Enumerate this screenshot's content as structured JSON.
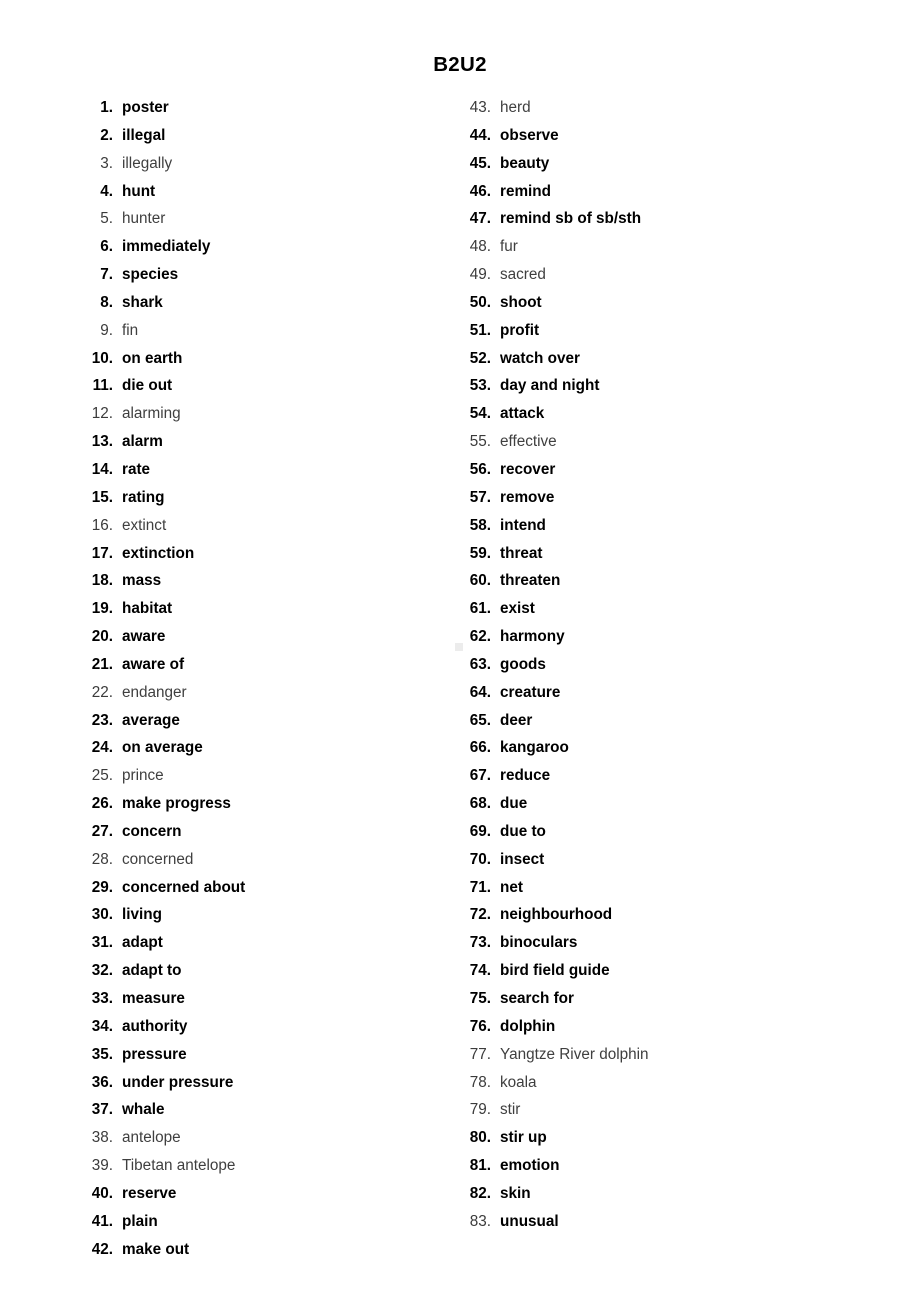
{
  "document": {
    "title": "B2U2"
  },
  "columns": {
    "left": {
      "name": "left-column",
      "items": [
        {
          "number": "1.",
          "text": "poster",
          "number_bold": true,
          "text_bold": true
        },
        {
          "number": "2.",
          "text": "illegal",
          "number_bold": true,
          "text_bold": true
        },
        {
          "number": "3.",
          "text": "illegally",
          "number_bold": false,
          "text_bold": false
        },
        {
          "number": "4.",
          "text": "hunt",
          "number_bold": true,
          "text_bold": true
        },
        {
          "number": "5.",
          "text": "hunter",
          "number_bold": false,
          "text_bold": false
        },
        {
          "number": "6.",
          "text": "immediately",
          "number_bold": true,
          "text_bold": true
        },
        {
          "number": "7.",
          "text": "species",
          "number_bold": true,
          "text_bold": true
        },
        {
          "number": "8.",
          "text": "shark",
          "number_bold": true,
          "text_bold": true
        },
        {
          "number": "9.",
          "text": "fin",
          "number_bold": false,
          "text_bold": false
        },
        {
          "number": "10.",
          "text": "on earth",
          "number_bold": true,
          "text_bold": true
        },
        {
          "number": "11.",
          "text": "die out",
          "number_bold": true,
          "text_bold": true
        },
        {
          "number": "12.",
          "text": "alarming",
          "number_bold": false,
          "text_bold": false
        },
        {
          "number": "13.",
          "text": "alarm",
          "number_bold": true,
          "text_bold": true
        },
        {
          "number": "14.",
          "text": "rate",
          "number_bold": true,
          "text_bold": true
        },
        {
          "number": "15.",
          "text": "rating",
          "number_bold": true,
          "text_bold": true
        },
        {
          "number": "16.",
          "text": "extinct",
          "number_bold": false,
          "text_bold": false
        },
        {
          "number": "17.",
          "text": "extinction",
          "number_bold": true,
          "text_bold": true
        },
        {
          "number": "18.",
          "text": "mass",
          "number_bold": true,
          "text_bold": true
        },
        {
          "number": "19.",
          "text": "habitat",
          "number_bold": true,
          "text_bold": true
        },
        {
          "number": "20.",
          "text": "aware",
          "number_bold": true,
          "text_bold": true
        },
        {
          "number": "21.",
          "text": "aware of",
          "number_bold": true,
          "text_bold": true
        },
        {
          "number": "22.",
          "text": "endanger",
          "number_bold": false,
          "text_bold": false
        },
        {
          "number": "23.",
          "text": "average",
          "number_bold": true,
          "text_bold": true
        },
        {
          "number": "24.",
          "text": "on average",
          "number_bold": true,
          "text_bold": true
        },
        {
          "number": "25.",
          "text": "prince",
          "number_bold": false,
          "text_bold": false
        },
        {
          "number": "26.",
          "text": "make progress",
          "number_bold": true,
          "text_bold": true
        },
        {
          "number": "27.",
          "text": "concern",
          "number_bold": true,
          "text_bold": true
        },
        {
          "number": "28.",
          "text": "concerned",
          "number_bold": false,
          "text_bold": false
        },
        {
          "number": "29.",
          "text": "concerned about",
          "number_bold": true,
          "text_bold": true
        },
        {
          "number": "30.",
          "text": "living",
          "number_bold": true,
          "text_bold": true
        },
        {
          "number": "31.",
          "text": "adapt",
          "number_bold": true,
          "text_bold": true
        },
        {
          "number": "32.",
          "text": "adapt to",
          "number_bold": true,
          "text_bold": true
        },
        {
          "number": "33.",
          "text": "measure",
          "number_bold": true,
          "text_bold": true
        },
        {
          "number": "34.",
          "text": "authority",
          "number_bold": true,
          "text_bold": true
        },
        {
          "number": "35.",
          "text": "pressure",
          "number_bold": true,
          "text_bold": true
        },
        {
          "number": "36.",
          "text": "under pressure",
          "number_bold": true,
          "text_bold": true
        },
        {
          "number": "37.",
          "text": "whale",
          "number_bold": true,
          "text_bold": true
        },
        {
          "number": "38.",
          "text": "antelope",
          "number_bold": false,
          "text_bold": false
        },
        {
          "number": "39.",
          "text": "Tibetan antelope",
          "number_bold": false,
          "text_bold": false
        },
        {
          "number": "40.",
          "text": "reserve",
          "number_bold": true,
          "text_bold": true
        },
        {
          "number": "41.",
          "text": "plain",
          "number_bold": true,
          "text_bold": true
        },
        {
          "number": "42.",
          "text": "make out",
          "number_bold": true,
          "text_bold": true
        }
      ]
    },
    "right": {
      "name": "right-column",
      "items": [
        {
          "number": "43.",
          "text": "herd",
          "number_bold": false,
          "text_bold": false
        },
        {
          "number": "44.",
          "text": "observe",
          "number_bold": true,
          "text_bold": true
        },
        {
          "number": "45.",
          "text": "beauty",
          "number_bold": true,
          "text_bold": true
        },
        {
          "number": "46.",
          "text": "remind",
          "number_bold": true,
          "text_bold": true
        },
        {
          "number": "47.",
          "text": "remind sb of sb/sth",
          "number_bold": true,
          "text_bold": true
        },
        {
          "number": "48.",
          "text": "fur",
          "number_bold": false,
          "text_bold": false
        },
        {
          "number": "49.",
          "text": "sacred",
          "number_bold": false,
          "text_bold": false
        },
        {
          "number": "50.",
          "text": "shoot",
          "number_bold": true,
          "text_bold": true
        },
        {
          "number": "51.",
          "text": "profit",
          "number_bold": true,
          "text_bold": true
        },
        {
          "number": "52.",
          "text": "watch over",
          "number_bold": true,
          "text_bold": true
        },
        {
          "number": "53.",
          "text": "day and night",
          "number_bold": true,
          "text_bold": true
        },
        {
          "number": "54.",
          "text": "attack",
          "number_bold": true,
          "text_bold": true
        },
        {
          "number": "55.",
          "text": "effective",
          "number_bold": false,
          "text_bold": false
        },
        {
          "number": "56.",
          "text": "recover",
          "number_bold": true,
          "text_bold": true
        },
        {
          "number": "57.",
          "text": "remove",
          "number_bold": true,
          "text_bold": true
        },
        {
          "number": "58.",
          "text": "intend",
          "number_bold": true,
          "text_bold": true
        },
        {
          "number": "59.",
          "text": "threat",
          "number_bold": true,
          "text_bold": true
        },
        {
          "number": "60.",
          "text": "threaten",
          "number_bold": true,
          "text_bold": true
        },
        {
          "number": "61.",
          "text": "exist",
          "number_bold": true,
          "text_bold": true
        },
        {
          "number": "62.",
          "text": "harmony",
          "number_bold": true,
          "text_bold": true
        },
        {
          "number": "63.",
          "text": "goods",
          "number_bold": true,
          "text_bold": true
        },
        {
          "number": "64.",
          "text": "creature",
          "number_bold": true,
          "text_bold": true
        },
        {
          "number": "65.",
          "text": "deer",
          "number_bold": true,
          "text_bold": true
        },
        {
          "number": "66.",
          "text": "kangaroo",
          "number_bold": true,
          "text_bold": true
        },
        {
          "number": "67.",
          "text": "reduce",
          "number_bold": true,
          "text_bold": true
        },
        {
          "number": "68.",
          "text": "due",
          "number_bold": true,
          "text_bold": true
        },
        {
          "number": "69.",
          "text": "due to",
          "number_bold": true,
          "text_bold": true
        },
        {
          "number": "70.",
          "text": "insect",
          "number_bold": true,
          "text_bold": true
        },
        {
          "number": "71.",
          "text": "net",
          "number_bold": true,
          "text_bold": true
        },
        {
          "number": "72.",
          "text": "neighbourhood",
          "number_bold": true,
          "text_bold": true
        },
        {
          "number": "73.",
          "text": "binoculars",
          "number_bold": true,
          "text_bold": true
        },
        {
          "number": "74.",
          "text": "bird field guide",
          "number_bold": true,
          "text_bold": true
        },
        {
          "number": "75.",
          "text": "search for",
          "number_bold": true,
          "text_bold": true
        },
        {
          "number": "76.",
          "text": "dolphin",
          "number_bold": true,
          "text_bold": true
        },
        {
          "number": "77.",
          "text": "Yangtze River dolphin",
          "number_bold": false,
          "text_bold": false
        },
        {
          "number": "78.",
          "text": "koala",
          "number_bold": false,
          "text_bold": false
        },
        {
          "number": "79.",
          "text": "stir",
          "number_bold": false,
          "text_bold": false
        },
        {
          "number": "80.",
          "text": "stir up",
          "number_bold": true,
          "text_bold": true
        },
        {
          "number": "81.",
          "text": "emotion",
          "number_bold": true,
          "text_bold": true
        },
        {
          "number": "82.",
          "text": "skin",
          "number_bold": true,
          "text_bold": true
        },
        {
          "number": "83.",
          "text": "unusual",
          "number_bold": false,
          "text_bold": true
        }
      ]
    }
  }
}
